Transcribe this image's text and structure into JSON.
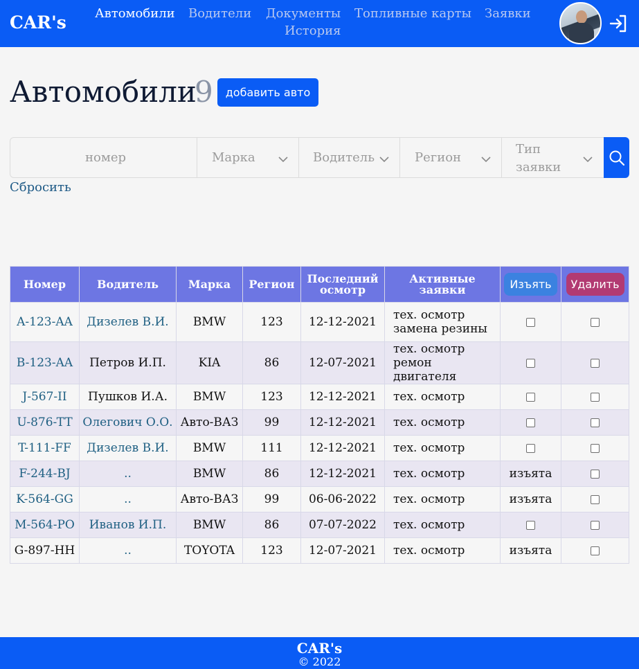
{
  "header": {
    "logo": "CAR's",
    "nav": [
      "Автомобили",
      "Водители",
      "Документы",
      "Топливные карты",
      "Заявки",
      "История"
    ]
  },
  "page": {
    "title": "Автомобили",
    "count": "9",
    "add_button": "добавить авто"
  },
  "filters": {
    "number_placeholder": "номер",
    "brand": "Марка",
    "driver": "Водитель",
    "region": "Регион",
    "request_type": "Тип заявки",
    "reset": "Сбросить"
  },
  "table": {
    "headers": {
      "number": "Номер",
      "driver": "Водитель",
      "brand": "Марка",
      "region": "Регион",
      "last_inspection": "Последний осмотр",
      "active_requests": "Активные заявки",
      "seize": "Изъять",
      "delete": "Удалить"
    },
    "rows": [
      {
        "number": "A-123-AA",
        "driver": "Дизелев В.И.",
        "brand": "BMW",
        "region": "123",
        "date": "12-12-2021",
        "req1": "тех. осмотр",
        "req2": "замена резины",
        "seized": ""
      },
      {
        "number": "B-123-AA",
        "driver": "Петров И.П.",
        "brand": "KIA",
        "region": "86",
        "date": "12-07-2021",
        "req1": "тех. осмотр",
        "req2": "ремон двигателя",
        "seized": ""
      },
      {
        "number": "J-567-II",
        "driver": "Пушков И.А.",
        "brand": "BMW",
        "region": "123",
        "date": "12-12-2021",
        "req1": "тех. осмотр",
        "req2": "",
        "seized": ""
      },
      {
        "number": "U-876-TT",
        "driver": "Олегович О.О.",
        "brand": "Авто-ВАЗ",
        "region": "99",
        "date": "12-12-2021",
        "req1": "тех. осмотр",
        "req2": "",
        "seized": ""
      },
      {
        "number": "T-111-FF",
        "driver": "Дизелев В.И.",
        "brand": "BMW",
        "region": "111",
        "date": "12-12-2021",
        "req1": "тех. осмотр",
        "req2": "",
        "seized": ""
      },
      {
        "number": "F-244-BJ",
        "driver": "..",
        "brand": "BMW",
        "region": "86",
        "date": "12-12-2021",
        "req1": "тех. осмотр",
        "req2": "",
        "seized": "изъята"
      },
      {
        "number": "K-564-GG",
        "driver": "..",
        "brand": "Авто-ВАЗ",
        "region": "99",
        "date": "06-06-2022",
        "req1": "тех. осмотр",
        "req2": "",
        "seized": "изъята"
      },
      {
        "number": "M-564-PO",
        "driver": "Иванов И.П.",
        "brand": "BMW",
        "region": "86",
        "date": "07-07-2022",
        "req1": "тех. осмотр",
        "req2": "",
        "seized": ""
      },
      {
        "number": "G-897-HH",
        "driver": "..",
        "brand": "TOYOTA",
        "region": "123",
        "date": "12-07-2021",
        "req1": "тех. осмотр",
        "req2": "",
        "seized": "изъята"
      }
    ]
  },
  "footer": {
    "title": "CAR's",
    "copyright": "© 2022"
  },
  "colors": {
    "primary": "#0a5cf5",
    "table_header": "#6d76e3",
    "seize_button": "#3b82e0",
    "delete_button": "#b23a72",
    "link": "#1e5f82"
  },
  "icons": {
    "logout": "logout-icon",
    "search": "search-icon",
    "dropdown": "chevron-down-icon",
    "avatar": "user-avatar"
  }
}
